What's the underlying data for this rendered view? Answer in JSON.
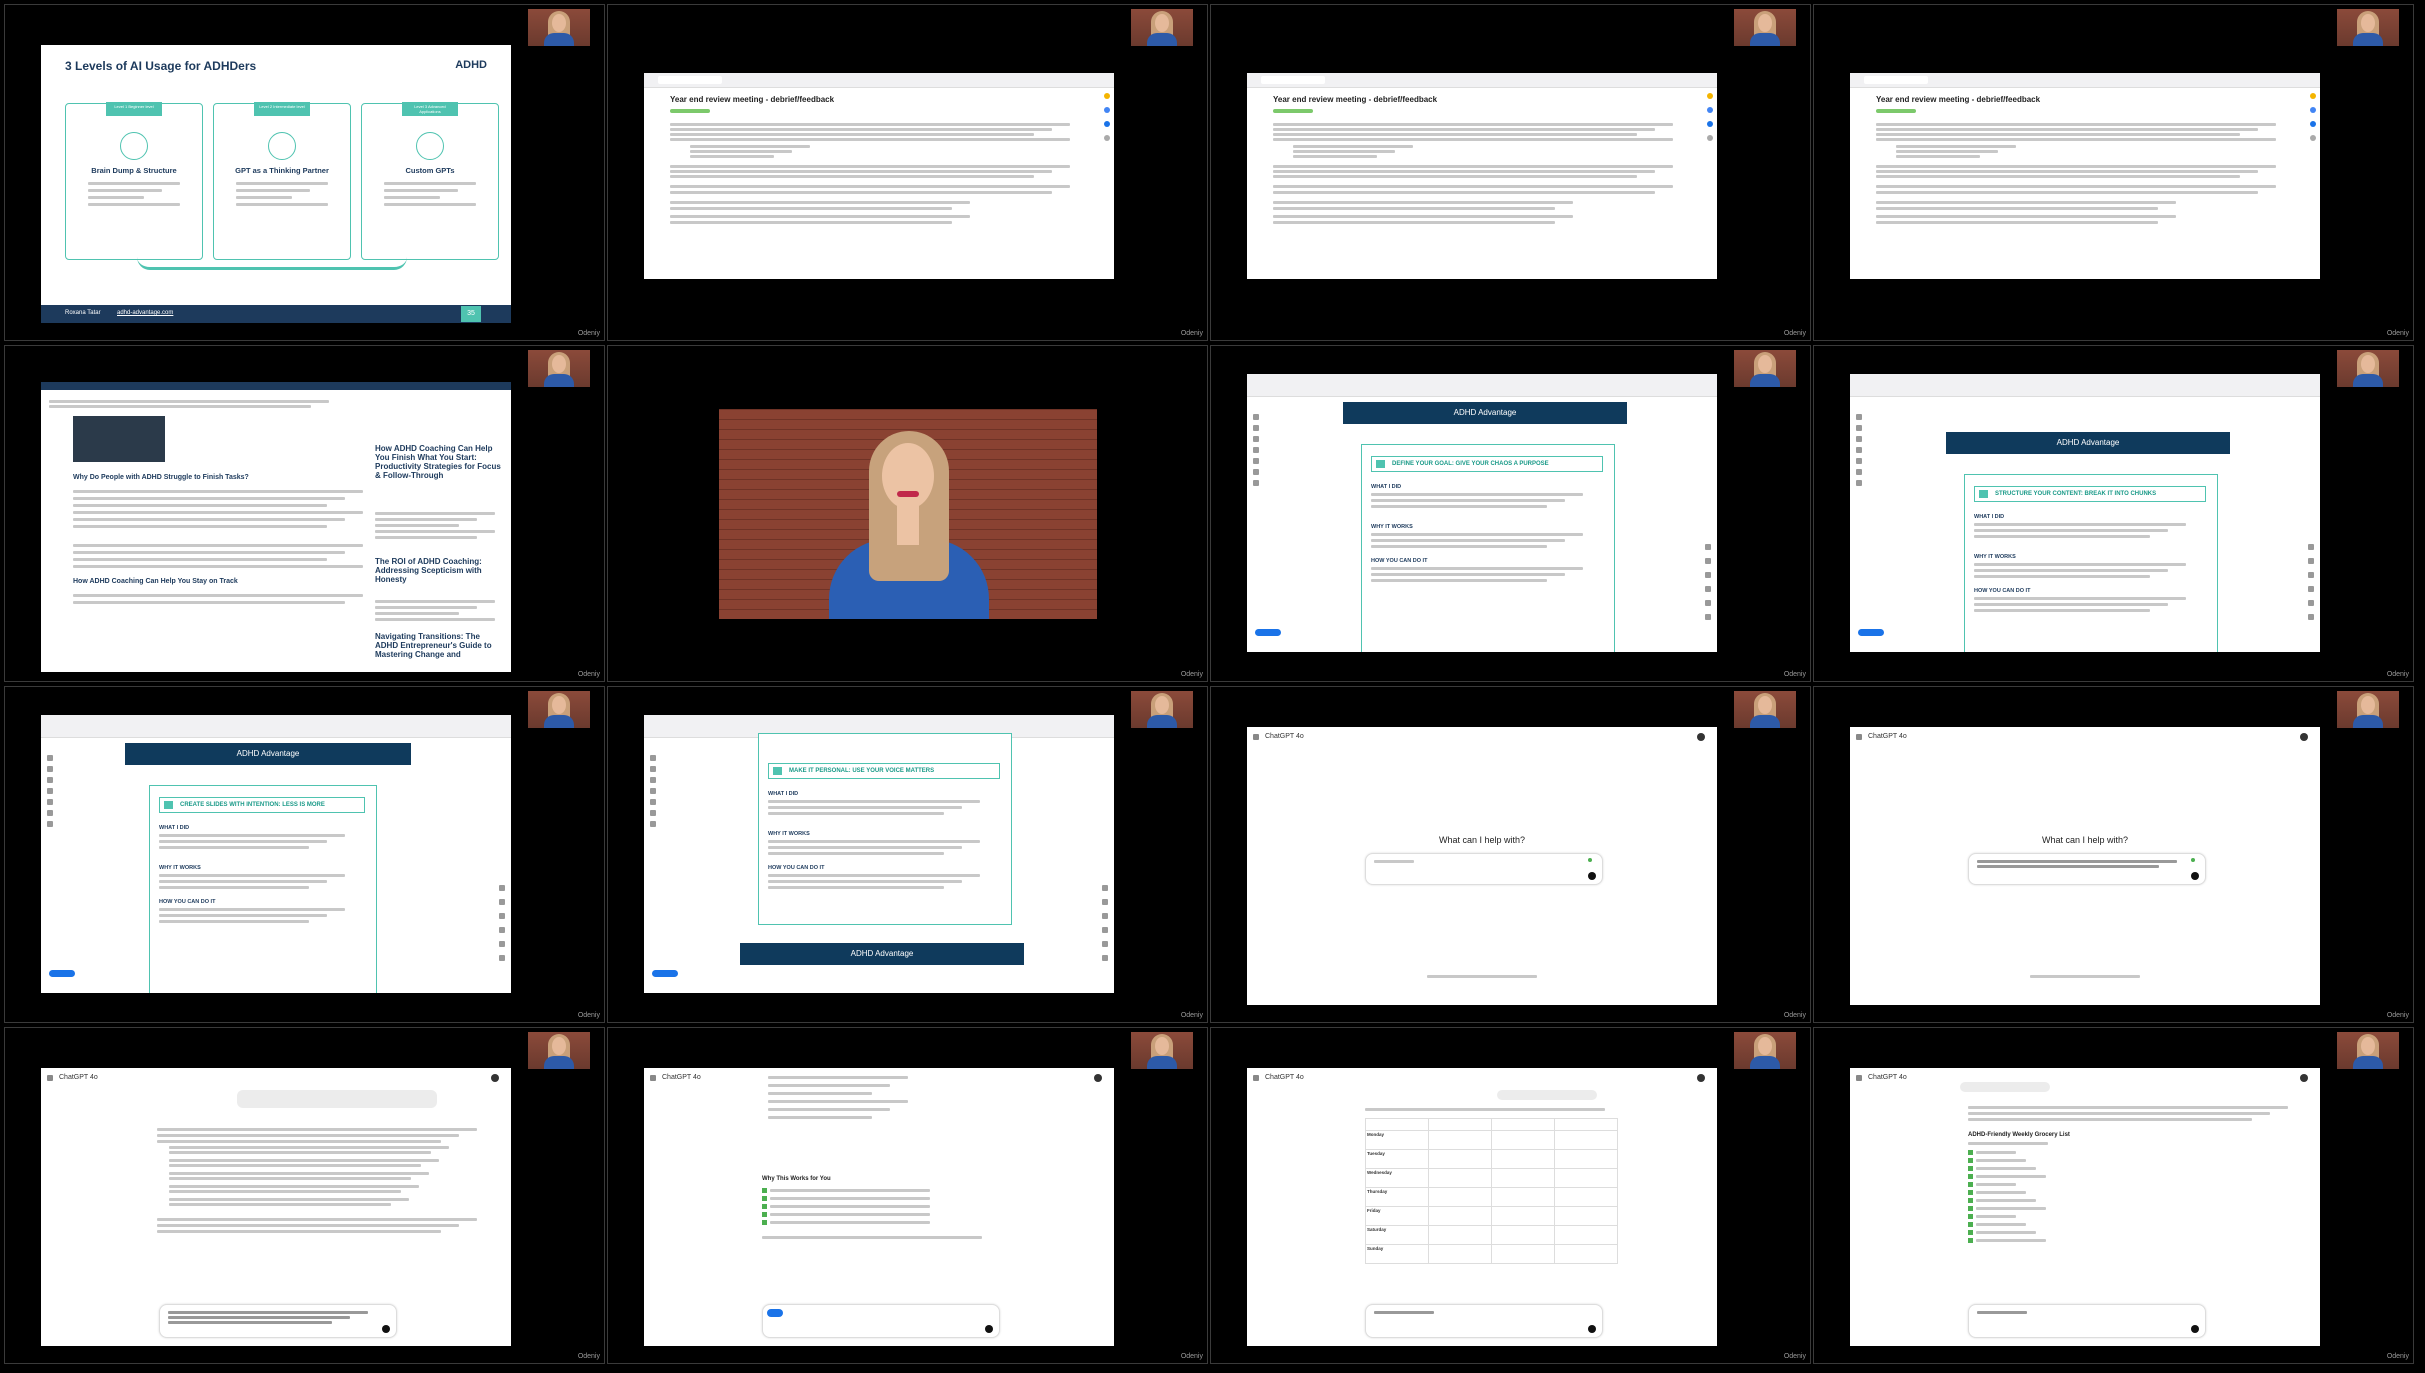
{
  "tiles": [
    {
      "label": "Odeniy",
      "type": "slide",
      "slide_title": "3 Levels of AI Usage for ADHDers",
      "logo": "ADHD",
      "cards": [
        {
          "level": "Level 1 Beginner level",
          "title": "Brain Dump & Structure"
        },
        {
          "level": "Level 2 Intermediate level",
          "title": "GPT as a Thinking Partner"
        },
        {
          "level": "Level 3 Advanced Applications",
          "title": "Custom GPTs"
        }
      ],
      "footer_name": "Roxana Tatar",
      "footer_url": "adhd-advantage.com",
      "page_num": "35"
    },
    {
      "label": "Odeniy",
      "type": "mail",
      "title": "Year end review meeting - debrief/feedback"
    },
    {
      "label": "Odeniy",
      "type": "mail",
      "title": "Year end review meeting - debrief/feedback"
    },
    {
      "label": "Odeniy",
      "type": "mail",
      "title": "Year end review meeting - debrief/feedback"
    },
    {
      "label": "Odeniy",
      "type": "blog",
      "h1": "Why Do People with ADHD Struggle to Finish Tasks?",
      "h2": "How ADHD Coaching Can Help You Stay on Track",
      "side1": "How ADHD Coaching Can Help You Finish What You Start: Productivity Strategies for Focus & Follow-Through",
      "side2": "The ROI of ADHD Coaching: Addressing Scepticism with Honesty",
      "side3": "Navigating Transitions: The ADHD Entrepreneur's Guide to Mastering Change and"
    },
    {
      "label": "Odeniy",
      "type": "video"
    },
    {
      "label": "Odeniy",
      "type": "doc",
      "banner": "ADHD Advantage",
      "heading": "DEFINE YOUR GOAL: GIVE YOUR CHAOS A PURPOSE",
      "s1": "WHAT I DID",
      "s2": "WHY IT WORKS",
      "s3": "HOW YOU CAN DO IT"
    },
    {
      "label": "Odeniy",
      "type": "doc2",
      "banner": "ADHD Advantage",
      "heading": "STRUCTURE YOUR CONTENT: BREAK IT INTO CHUNKS",
      "s1": "WHAT I DID",
      "s2": "WHY IT WORKS",
      "s3": "HOW YOU CAN DO IT"
    },
    {
      "label": "Odeniy",
      "type": "doc",
      "banner": "ADHD Advantage",
      "heading": "CREATE SLIDES WITH INTENTION: LESS IS MORE",
      "s1": "WHAT I DID",
      "s2": "WHY IT WORKS",
      "s3": "HOW YOU CAN DO IT"
    },
    {
      "label": "Odeniy",
      "type": "doc3",
      "banner": "ADHD Advantage",
      "heading": "MAKE IT PERSONAL: USE YOUR VOICE MATTERS",
      "s1": "WHAT I DID",
      "s2": "WHY IT WORKS",
      "s3": "HOW YOU CAN DO IT"
    },
    {
      "label": "Odeniy",
      "type": "chat-empty",
      "app": "ChatGPT 4o",
      "title": "What can I help with?"
    },
    {
      "label": "Odeniy",
      "type": "chat-typed",
      "app": "ChatGPT 4o",
      "title": "What can I help with?"
    },
    {
      "label": "Odeniy",
      "type": "chat-list",
      "app": "ChatGPT 4o"
    },
    {
      "label": "Odeniy",
      "type": "chat-checks",
      "app": "ChatGPT 4o",
      "section": "Why This Works for You"
    },
    {
      "label": "Odeniy",
      "type": "chat-table",
      "app": "ChatGPT 4o",
      "days": [
        "Monday",
        "Tuesday",
        "Wednesday",
        "Thursday",
        "Friday",
        "Saturday",
        "Sunday"
      ]
    },
    {
      "label": "Odeniy",
      "type": "chat-grocery",
      "app": "ChatGPT 4o",
      "section": "ADHD-Friendly Weekly Grocery List"
    }
  ]
}
